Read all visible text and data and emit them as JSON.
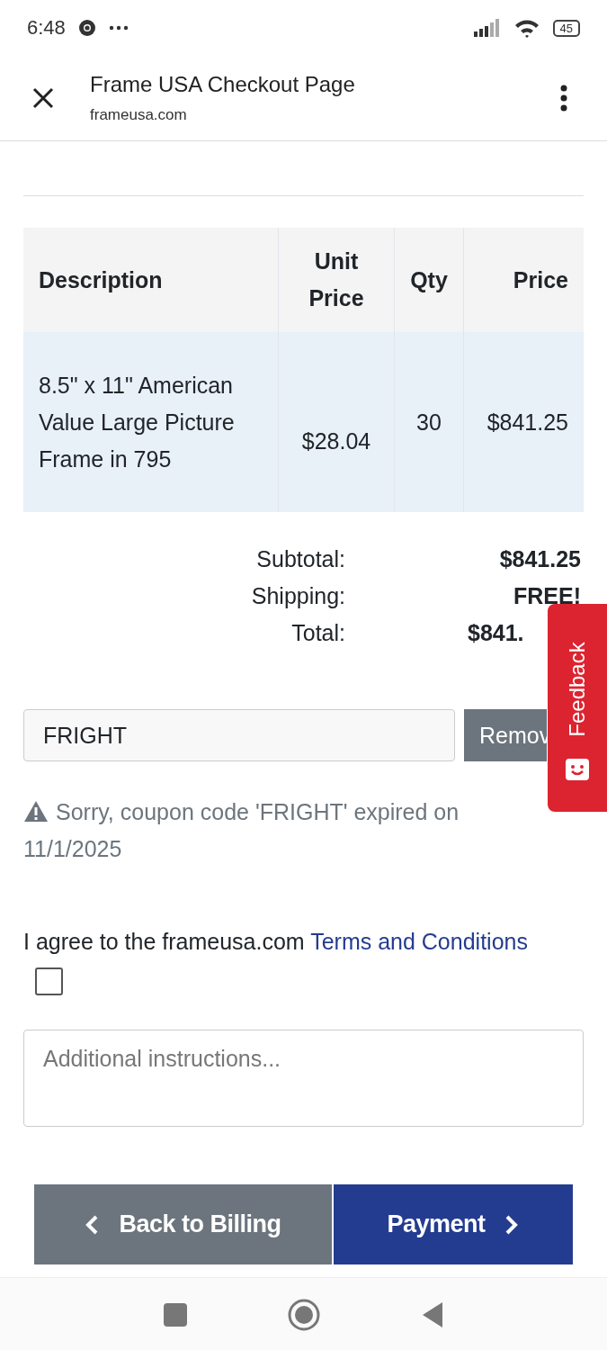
{
  "status_bar": {
    "time": "6:48",
    "battery": "45"
  },
  "header": {
    "title": "Frame USA Checkout Page",
    "url": "frameusa.com"
  },
  "table": {
    "columns": [
      "Description",
      "Unit Price",
      "Qty",
      "Price"
    ],
    "rows": [
      {
        "cells": [
          "8.5\" x 11\" American Value Large Picture Frame in 795",
          "$28.04",
          "30",
          "$841.25"
        ]
      }
    ]
  },
  "totals": [
    {
      "label": "Subtotal:",
      "value": "$841.25"
    },
    {
      "label": "Shipping:",
      "value": "FREE!"
    },
    {
      "label": "Total:",
      "value": "$841."
    }
  ],
  "coupon": {
    "value": "FRIGHT",
    "button": "Remov"
  },
  "feedback_tab": {
    "label": "Feedback"
  },
  "warning": "Sorry, coupon code 'FRIGHT' expired on 11/1/2025",
  "terms": {
    "text": "I agree to the frameusa.com ",
    "link": "Terms and Conditions",
    "checked": false
  },
  "instructions": {
    "placeholder": "Additional instructions..."
  },
  "buttons": {
    "back": "Back to Billing",
    "next": "Payment"
  }
}
